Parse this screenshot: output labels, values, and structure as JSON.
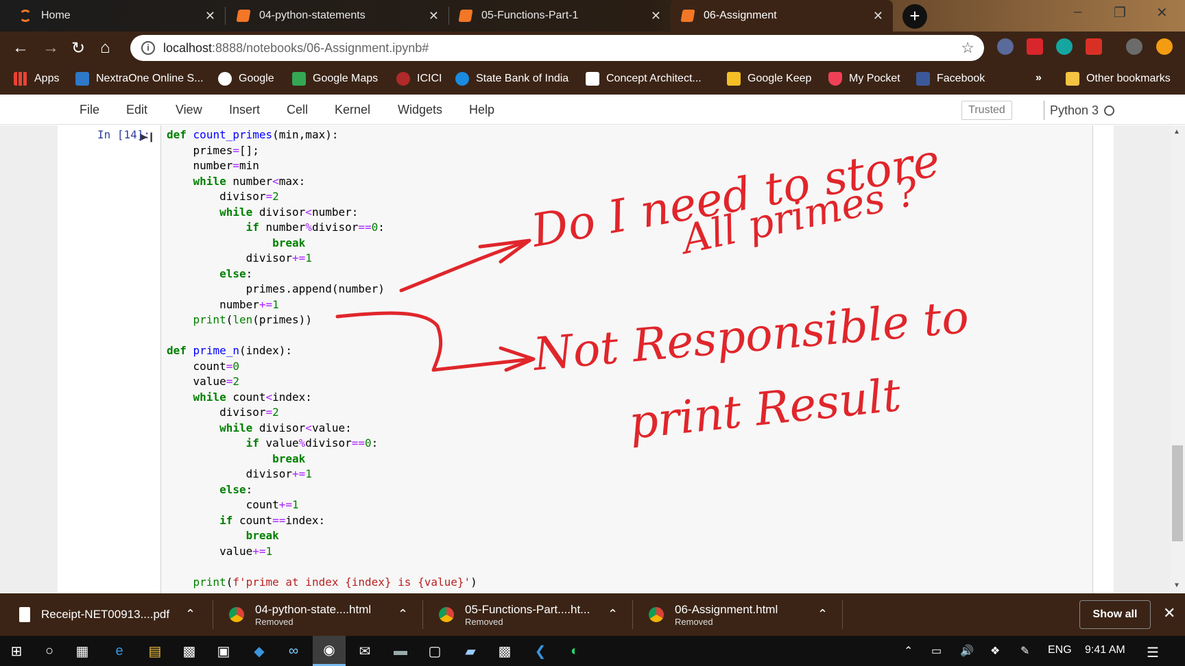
{
  "browser": {
    "tabs": [
      {
        "title": "Home"
      },
      {
        "title": "04-python-statements"
      },
      {
        "title": "05-Functions-Part-1"
      },
      {
        "title": "06-Assignment"
      }
    ],
    "close_glyph": "✕",
    "new_tab_glyph": "+",
    "url_host": "localhost",
    "url_path": ":8888/notebooks/06-Assignment.ipynb#",
    "bookmarks": [
      "Apps",
      "NextraOne Online S...",
      "Google",
      "Google Maps",
      "ICICI",
      "State Bank of India",
      "Concept Architect...",
      "Google Keep",
      "My Pocket",
      "Facebook"
    ],
    "more_glyph": "»",
    "other_bookmarks": "Other bookmarks"
  },
  "jupyter": {
    "menu": [
      "File",
      "Edit",
      "View",
      "Insert",
      "Cell",
      "Kernel",
      "Widgets",
      "Help"
    ],
    "trusted": "Trusted",
    "kernel": "Python 3",
    "cell_prompt": "In [14]:"
  },
  "code_lines": [
    [
      [
        "k",
        "def"
      ],
      [
        "t",
        " "
      ],
      [
        "f",
        "count_primes"
      ],
      [
        "t",
        "(min,max):"
      ]
    ],
    [
      [
        "t",
        "    primes"
      ],
      [
        "o",
        "="
      ],
      [
        "t",
        "[];"
      ]
    ],
    [
      [
        "t",
        "    number"
      ],
      [
        "o",
        "="
      ],
      [
        "t",
        "min"
      ]
    ],
    [
      [
        "t",
        "    "
      ],
      [
        "k",
        "while"
      ],
      [
        "t",
        " number"
      ],
      [
        "o",
        "<"
      ],
      [
        "t",
        "max:"
      ]
    ],
    [
      [
        "t",
        "        divisor"
      ],
      [
        "o",
        "="
      ],
      [
        "n",
        "2"
      ]
    ],
    [
      [
        "t",
        "        "
      ],
      [
        "k",
        "while"
      ],
      [
        "t",
        " divisor"
      ],
      [
        "o",
        "<"
      ],
      [
        "t",
        "number:"
      ]
    ],
    [
      [
        "t",
        "            "
      ],
      [
        "k",
        "if"
      ],
      [
        "t",
        " number"
      ],
      [
        "o",
        "%"
      ],
      [
        "t",
        "divisor"
      ],
      [
        "o",
        "=="
      ],
      [
        "n",
        "0"
      ],
      [
        "t",
        ":"
      ]
    ],
    [
      [
        "t",
        "                "
      ],
      [
        "k",
        "break"
      ]
    ],
    [
      [
        "t",
        "            divisor"
      ],
      [
        "o",
        "+="
      ],
      [
        "n",
        "1"
      ]
    ],
    [
      [
        "t",
        "        "
      ],
      [
        "k",
        "else"
      ],
      [
        "t",
        ":"
      ]
    ],
    [
      [
        "t",
        "            primes.append(number)"
      ]
    ],
    [
      [
        "t",
        "        number"
      ],
      [
        "o",
        "+="
      ],
      [
        "n",
        "1"
      ]
    ],
    [
      [
        "t",
        "    "
      ],
      [
        "n",
        "print"
      ],
      [
        "t",
        "("
      ],
      [
        "n",
        "len"
      ],
      [
        "t",
        "(primes))"
      ]
    ],
    [],
    [
      [
        "k",
        "def"
      ],
      [
        "t",
        " "
      ],
      [
        "f",
        "prime_n"
      ],
      [
        "t",
        "(index):"
      ]
    ],
    [
      [
        "t",
        "    count"
      ],
      [
        "o",
        "="
      ],
      [
        "n",
        "0"
      ]
    ],
    [
      [
        "t",
        "    value"
      ],
      [
        "o",
        "="
      ],
      [
        "n",
        "2"
      ]
    ],
    [
      [
        "t",
        "    "
      ],
      [
        "k",
        "while"
      ],
      [
        "t",
        " count"
      ],
      [
        "o",
        "<"
      ],
      [
        "t",
        "index:"
      ]
    ],
    [
      [
        "t",
        "        divisor"
      ],
      [
        "o",
        "="
      ],
      [
        "n",
        "2"
      ]
    ],
    [
      [
        "t",
        "        "
      ],
      [
        "k",
        "while"
      ],
      [
        "t",
        " divisor"
      ],
      [
        "o",
        "<"
      ],
      [
        "t",
        "value:"
      ]
    ],
    [
      [
        "t",
        "            "
      ],
      [
        "k",
        "if"
      ],
      [
        "t",
        " value"
      ],
      [
        "o",
        "%"
      ],
      [
        "t",
        "divisor"
      ],
      [
        "o",
        "=="
      ],
      [
        "n",
        "0"
      ],
      [
        "t",
        ":"
      ]
    ],
    [
      [
        "t",
        "                "
      ],
      [
        "k",
        "break"
      ]
    ],
    [
      [
        "t",
        "            divisor"
      ],
      [
        "o",
        "+="
      ],
      [
        "n",
        "1"
      ]
    ],
    [
      [
        "t",
        "        "
      ],
      [
        "k",
        "else"
      ],
      [
        "t",
        ":"
      ]
    ],
    [
      [
        "t",
        "            count"
      ],
      [
        "o",
        "+="
      ],
      [
        "n",
        "1"
      ]
    ],
    [
      [
        "t",
        "        "
      ],
      [
        "k",
        "if"
      ],
      [
        "t",
        " count"
      ],
      [
        "o",
        "=="
      ],
      [
        "t",
        "index:"
      ]
    ],
    [
      [
        "t",
        "            "
      ],
      [
        "k",
        "break"
      ]
    ],
    [
      [
        "t",
        "        value"
      ],
      [
        "o",
        "+="
      ],
      [
        "n",
        "1"
      ]
    ],
    [],
    [
      [
        "t",
        "    "
      ],
      [
        "n",
        "print"
      ],
      [
        "t",
        "("
      ],
      [
        "s",
        "f'prime at index {index} is {value}'"
      ],
      [
        "t",
        ")"
      ]
    ]
  ],
  "downloads": [
    {
      "name": "Receipt-NET00913....pdf",
      "status": ""
    },
    {
      "name": "04-python-state....html",
      "status": "Removed"
    },
    {
      "name": "05-Functions-Part....ht...",
      "status": "Removed"
    },
    {
      "name": "06-Assignment.html",
      "status": "Removed"
    }
  ],
  "show_all": "Show all",
  "taskbar": {
    "language": "ENG",
    "time": "9:41 AM"
  },
  "colors": {
    "chrome_bg": "#3b2416",
    "annotation_red": "#e0262b",
    "keyword_green": "#008000",
    "prompt_blue": "#303f9f"
  }
}
